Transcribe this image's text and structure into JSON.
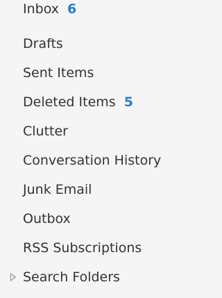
{
  "folders": [
    {
      "label": "Inbox",
      "count": "6"
    },
    {
      "label": "Drafts"
    },
    {
      "label": "Sent Items"
    },
    {
      "label": "Deleted Items",
      "count": "5"
    },
    {
      "label": "Clutter"
    },
    {
      "label": "Conversation History"
    },
    {
      "label": "Junk Email"
    },
    {
      "label": "Outbox"
    },
    {
      "label": "RSS Subscriptions"
    },
    {
      "label": "Search Folders",
      "collapsed": true
    }
  ],
  "colors": {
    "background": "#f5f5f5",
    "text": "#333333",
    "unread_count": "#2b7cd3",
    "expand_arrow": "#8a8a8a"
  },
  "icons": {
    "expand": "triangle-right-outline"
  }
}
